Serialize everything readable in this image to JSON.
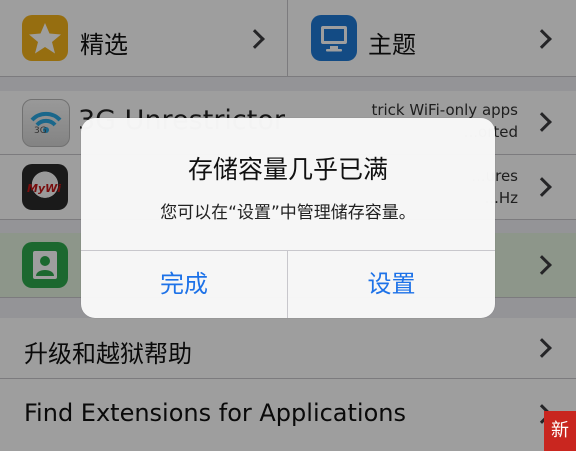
{
  "top_row": {
    "left": {
      "label": "精选",
      "icon": "star-icon"
    },
    "right": {
      "label": "主题",
      "icon": "display-icon"
    }
  },
  "tweaks": [
    {
      "title": "3G Unrestrictor",
      "desc": [
        "trick WiFi-only apps",
        "...orted"
      ],
      "icon": "wifi-3g-icon"
    },
    {
      "title": "",
      "desc": [
        "...ures",
        "...Hz"
      ],
      "icon": "mywi-icon"
    },
    {
      "title": "",
      "desc": [],
      "icon": "contact-icon"
    }
  ],
  "mywi_icon_text": "MyWi",
  "wifi_icon_text": "3G",
  "menu": {
    "upgrade_help": "升级和越狱帮助",
    "find_extensions": "Find Extensions for Applications"
  },
  "alert": {
    "title": "存储容量几乎已满",
    "message": "您可以在“设置”中管理储存容量。",
    "buttons": {
      "done": "完成",
      "settings": "设置"
    }
  },
  "badge": "新",
  "colors": {
    "accent": "#1d72e8",
    "star": "#f2b21b",
    "theme": "#1f7ad6",
    "contact": "#2ea84c",
    "badge": "#c9261f"
  }
}
